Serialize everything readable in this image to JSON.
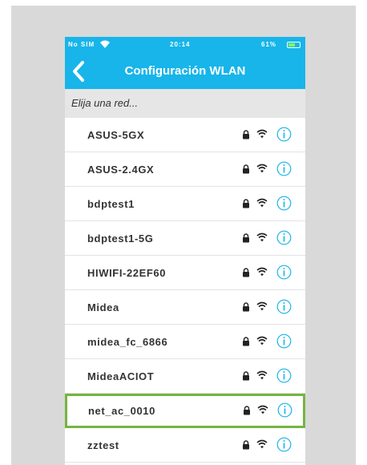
{
  "status_bar": {
    "carrier": "No SIM",
    "time": "20:14",
    "battery": "61%",
    "battery_level": 0.61
  },
  "header": {
    "title": "Configuración WLAN"
  },
  "prompt": "Elija una red...",
  "networks": [
    {
      "name": "ASUS-5GX",
      "locked": true,
      "selected": false
    },
    {
      "name": "ASUS-2.4GX",
      "locked": true,
      "selected": false
    },
    {
      "name": "bdptest1",
      "locked": true,
      "selected": false
    },
    {
      "name": "bdptest1-5G",
      "locked": true,
      "selected": false
    },
    {
      "name": "HIWIFI-22EF60",
      "locked": true,
      "selected": false
    },
    {
      "name": "Midea",
      "locked": true,
      "selected": false
    },
    {
      "name": "midea_fc_6866",
      "locked": true,
      "selected": false
    },
    {
      "name": "MideaACIOT",
      "locked": true,
      "selected": false
    },
    {
      "name": "net_ac_0010",
      "locked": true,
      "selected": true
    },
    {
      "name": "zztest",
      "locked": true,
      "selected": false
    }
  ],
  "colors": {
    "accent": "#17b5ea",
    "selection_border": "#76b442",
    "info_icon": "#17b5ea"
  }
}
